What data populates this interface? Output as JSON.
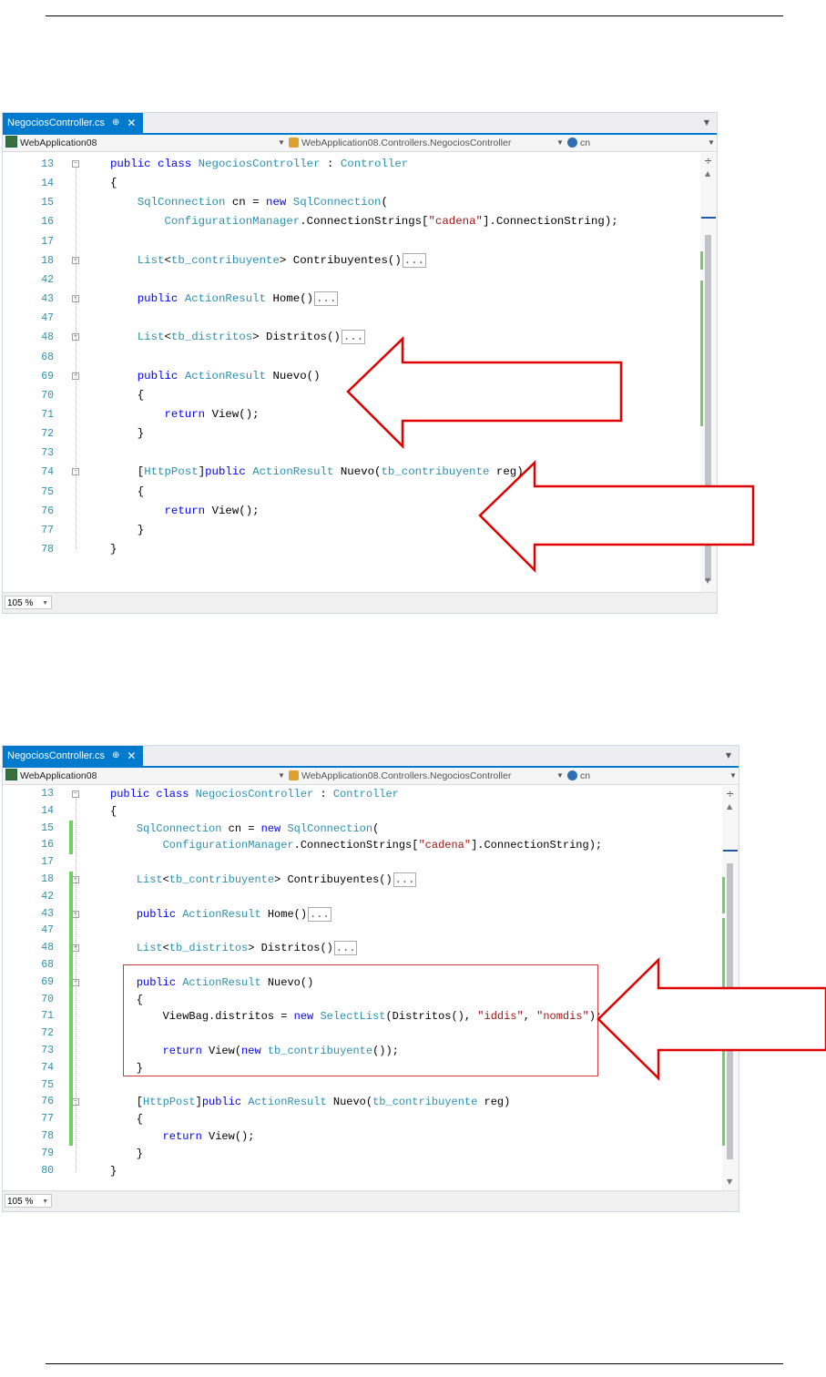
{
  "colors": {
    "accent": "#007acc",
    "keyword": "#0000ff",
    "type": "#2b91af",
    "string": "#a31515",
    "change_bar": "#6fd063",
    "arrow": "#e00000"
  },
  "screenshot1": {
    "tab": {
      "title": "NegociosController.cs",
      "pin": "⊕",
      "close": "✕"
    },
    "nav": {
      "project": "WebApplication08",
      "class": "WebApplication08.Controllers.NegociosController",
      "member": "cn"
    },
    "zoom": "105 %",
    "lines": [
      {
        "n": "13",
        "fold": "minus",
        "parts": [
          {
            "t": "public class ",
            "c": "kw"
          },
          {
            "t": "NegociosController",
            "c": "ty"
          },
          {
            "t": " : "
          },
          {
            "t": "Controller",
            "c": "ty"
          }
        ]
      },
      {
        "n": "14",
        "parts": [
          {
            "t": "{"
          }
        ]
      },
      {
        "n": "15",
        "parts": [
          {
            "t": "    "
          },
          {
            "t": "SqlConnection",
            "c": "ty"
          },
          {
            "t": " cn = "
          },
          {
            "t": "new ",
            "c": "kw"
          },
          {
            "t": "SqlConnection",
            "c": "ty"
          },
          {
            "t": "("
          }
        ]
      },
      {
        "n": "16",
        "parts": [
          {
            "t": "        "
          },
          {
            "t": "ConfigurationManager",
            "c": "ty"
          },
          {
            "t": ".ConnectionStrings["
          },
          {
            "t": "\"cadena\"",
            "c": "st"
          },
          {
            "t": "].ConnectionString);"
          }
        ]
      },
      {
        "n": "17",
        "parts": []
      },
      {
        "n": "18",
        "fold": "plus",
        "parts": [
          {
            "t": "    "
          },
          {
            "t": "List",
            "c": "ty"
          },
          {
            "t": "<"
          },
          {
            "t": "tb_contribuyente",
            "c": "ty"
          },
          {
            "t": "> Contribuyentes()"
          },
          {
            "t": "...",
            "c": "collapsed"
          }
        ]
      },
      {
        "n": "42",
        "parts": []
      },
      {
        "n": "43",
        "fold": "plus",
        "parts": [
          {
            "t": "    "
          },
          {
            "t": "public ",
            "c": "kw"
          },
          {
            "t": "ActionResult",
            "c": "ty"
          },
          {
            "t": " Home()"
          },
          {
            "t": "...",
            "c": "collapsed"
          }
        ]
      },
      {
        "n": "47",
        "parts": []
      },
      {
        "n": "48",
        "fold": "plus",
        "parts": [
          {
            "t": "    "
          },
          {
            "t": "List",
            "c": "ty"
          },
          {
            "t": "<"
          },
          {
            "t": "tb_distritos",
            "c": "ty"
          },
          {
            "t": "> Distritos()"
          },
          {
            "t": "...",
            "c": "collapsed"
          }
        ]
      },
      {
        "n": "68",
        "parts": []
      },
      {
        "n": "69",
        "fold": "minus",
        "parts": [
          {
            "t": "    "
          },
          {
            "t": "public ",
            "c": "kw"
          },
          {
            "t": "ActionResult",
            "c": "ty"
          },
          {
            "t": " Nuevo()"
          }
        ]
      },
      {
        "n": "70",
        "parts": [
          {
            "t": "    {"
          }
        ]
      },
      {
        "n": "71",
        "parts": [
          {
            "t": "        "
          },
          {
            "t": "return ",
            "c": "kw"
          },
          {
            "t": "View();"
          }
        ]
      },
      {
        "n": "72",
        "parts": [
          {
            "t": "    }"
          }
        ]
      },
      {
        "n": "73",
        "parts": []
      },
      {
        "n": "74",
        "fold": "minus",
        "parts": [
          {
            "t": "    ["
          },
          {
            "t": "HttpPost",
            "c": "ty"
          },
          {
            "t": "]"
          },
          {
            "t": "public ",
            "c": "kw"
          },
          {
            "t": "ActionResult",
            "c": "ty"
          },
          {
            "t": " Nuevo("
          },
          {
            "t": "tb_contribuyente",
            "c": "ty"
          },
          {
            "t": " reg)"
          }
        ]
      },
      {
        "n": "75",
        "parts": [
          {
            "t": "    {"
          }
        ]
      },
      {
        "n": "76",
        "parts": [
          {
            "t": "        "
          },
          {
            "t": "return ",
            "c": "kw"
          },
          {
            "t": "View();"
          }
        ]
      },
      {
        "n": "77",
        "parts": [
          {
            "t": "    }"
          }
        ]
      },
      {
        "n": "78",
        "parts": [
          {
            "t": "}"
          }
        ]
      }
    ]
  },
  "screenshot2": {
    "tab": {
      "title": "NegociosController.cs",
      "pin": "⊕",
      "close": "✕"
    },
    "nav": {
      "project": "WebApplication08",
      "class": "WebApplication08.Controllers.NegociosController",
      "member": "cn"
    },
    "zoom": "105 %",
    "lines": [
      {
        "n": "13",
        "fold": "minus",
        "parts": [
          {
            "t": "public class ",
            "c": "kw"
          },
          {
            "t": "NegociosController",
            "c": "ty"
          },
          {
            "t": " : "
          },
          {
            "t": "Controller",
            "c": "ty"
          }
        ]
      },
      {
        "n": "14",
        "parts": [
          {
            "t": "{"
          }
        ]
      },
      {
        "n": "15",
        "parts": [
          {
            "t": "    "
          },
          {
            "t": "SqlConnection",
            "c": "ty"
          },
          {
            "t": " cn = "
          },
          {
            "t": "new ",
            "c": "kw"
          },
          {
            "t": "SqlConnection",
            "c": "ty"
          },
          {
            "t": "("
          }
        ]
      },
      {
        "n": "16",
        "parts": [
          {
            "t": "        "
          },
          {
            "t": "ConfigurationManager",
            "c": "ty"
          },
          {
            "t": ".ConnectionStrings["
          },
          {
            "t": "\"cadena\"",
            "c": "st"
          },
          {
            "t": "].ConnectionString);"
          }
        ]
      },
      {
        "n": "17",
        "parts": []
      },
      {
        "n": "18",
        "fold": "plus",
        "parts": [
          {
            "t": "    "
          },
          {
            "t": "List",
            "c": "ty"
          },
          {
            "t": "<"
          },
          {
            "t": "tb_contribuyente",
            "c": "ty"
          },
          {
            "t": "> Contribuyentes()"
          },
          {
            "t": "...",
            "c": "collapsed"
          }
        ]
      },
      {
        "n": "42",
        "parts": []
      },
      {
        "n": "43",
        "fold": "plus",
        "parts": [
          {
            "t": "    "
          },
          {
            "t": "public ",
            "c": "kw"
          },
          {
            "t": "ActionResult",
            "c": "ty"
          },
          {
            "t": " Home()"
          },
          {
            "t": "...",
            "c": "collapsed"
          }
        ]
      },
      {
        "n": "47",
        "parts": []
      },
      {
        "n": "48",
        "fold": "plus",
        "parts": [
          {
            "t": "    "
          },
          {
            "t": "List",
            "c": "ty"
          },
          {
            "t": "<"
          },
          {
            "t": "tb_distritos",
            "c": "ty"
          },
          {
            "t": "> Distritos()"
          },
          {
            "t": "...",
            "c": "collapsed"
          }
        ]
      },
      {
        "n": "68",
        "parts": []
      },
      {
        "n": "69",
        "fold": "minus",
        "parts": [
          {
            "t": "    "
          },
          {
            "t": "public ",
            "c": "kw"
          },
          {
            "t": "ActionResult",
            "c": "ty"
          },
          {
            "t": " Nuevo()"
          }
        ]
      },
      {
        "n": "70",
        "parts": [
          {
            "t": "    {"
          }
        ]
      },
      {
        "n": "71",
        "parts": [
          {
            "t": "        ViewBag.distritos = "
          },
          {
            "t": "new ",
            "c": "kw"
          },
          {
            "t": "SelectList",
            "c": "ty"
          },
          {
            "t": "(Distritos(), "
          },
          {
            "t": "\"iddis\"",
            "c": "st"
          },
          {
            "t": ", "
          },
          {
            "t": "\"nomdis\"",
            "c": "st"
          },
          {
            "t": ");"
          }
        ]
      },
      {
        "n": "72",
        "parts": []
      },
      {
        "n": "73",
        "parts": [
          {
            "t": "        "
          },
          {
            "t": "return ",
            "c": "kw"
          },
          {
            "t": "View("
          },
          {
            "t": "new ",
            "c": "kw"
          },
          {
            "t": "tb_contribuyente",
            "c": "ty"
          },
          {
            "t": "());"
          }
        ]
      },
      {
        "n": "74",
        "parts": [
          {
            "t": "    }"
          }
        ]
      },
      {
        "n": "75",
        "parts": []
      },
      {
        "n": "76",
        "fold": "minus",
        "parts": [
          {
            "t": "    ["
          },
          {
            "t": "HttpPost",
            "c": "ty"
          },
          {
            "t": "]"
          },
          {
            "t": "public ",
            "c": "kw"
          },
          {
            "t": "ActionResult",
            "c": "ty"
          },
          {
            "t": " Nuevo("
          },
          {
            "t": "tb_contribuyente",
            "c": "ty"
          },
          {
            "t": " reg)"
          }
        ]
      },
      {
        "n": "77",
        "parts": [
          {
            "t": "    {"
          }
        ]
      },
      {
        "n": "78",
        "parts": [
          {
            "t": "        "
          },
          {
            "t": "return ",
            "c": "kw"
          },
          {
            "t": "View();"
          }
        ]
      },
      {
        "n": "79",
        "parts": [
          {
            "t": "    }"
          }
        ]
      },
      {
        "n": "80",
        "parts": [
          {
            "t": "}"
          }
        ]
      }
    ]
  }
}
